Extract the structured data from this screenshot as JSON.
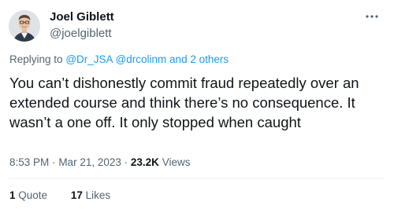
{
  "author": {
    "name": "Joel Giblett",
    "handle": "@joelgiblett"
  },
  "reply": {
    "prefix": "Replying to",
    "mentions": [
      "@Dr_JSA",
      "@drcolinm"
    ],
    "conjunction": "and",
    "others": "2 others"
  },
  "tweet": {
    "text": "You can’t dishonestly commit fraud repeatedly over an extended course and think there’s no consequence. It wasn’t a one off. It only stopped when caught"
  },
  "meta": {
    "time": "8:53 PM",
    "separator": "·",
    "date": "Mar 21, 2023",
    "views_count": "23.2K",
    "views_label": "Views"
  },
  "stats": {
    "quotes_count": "1",
    "quotes_label": "Quote",
    "likes_count": "17",
    "likes_label": "Likes"
  },
  "icons": {
    "more": "more-horizontal-icon"
  },
  "colors": {
    "text": "#0f1419",
    "secondary": "#536471",
    "link": "#1d9bf0",
    "divider": "#eff3f4"
  }
}
